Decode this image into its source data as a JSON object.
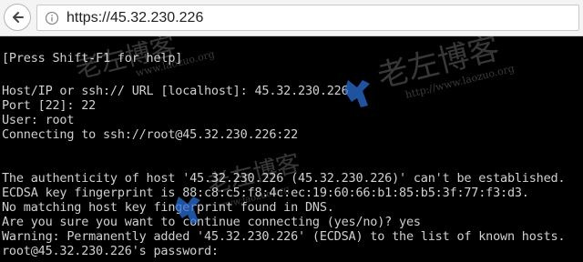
{
  "browser": {
    "url": "https://45.32.230.226"
  },
  "terminal": {
    "lines": [
      "[Press Shift-F1 for help]",
      "",
      "Host/IP or ssh:// URL [localhost]: 45.32.230.226",
      "Port [22]: 22",
      "User: root",
      "Connecting to ssh://root@45.32.230.226:22",
      "",
      "",
      "The authenticity of host '45.32.230.226 (45.32.230.226)' can't be established.",
      "ECDSA key fingerprint is 88:c8:c5:f8:4c:ec:19:60:66:b1:85:b5:3f:77:f3:d3.",
      "No matching host key fingerprint found in DNS.",
      "Are you sure you want to continue connecting (yes/no)? yes",
      "Warning: Permanently added '45.32.230.226' (ECDSA) to the list of known hosts.",
      "root@45.32.230.226's password:"
    ]
  },
  "watermark": {
    "title": "老左博客",
    "url": "www.laozuo.org",
    "url_alt": "http://www.laozuo.org"
  },
  "colors": {
    "terminal_bg": "#000000",
    "terminal_fg": "#d0d0d0",
    "watermark_logo": "#2a6fd6"
  }
}
